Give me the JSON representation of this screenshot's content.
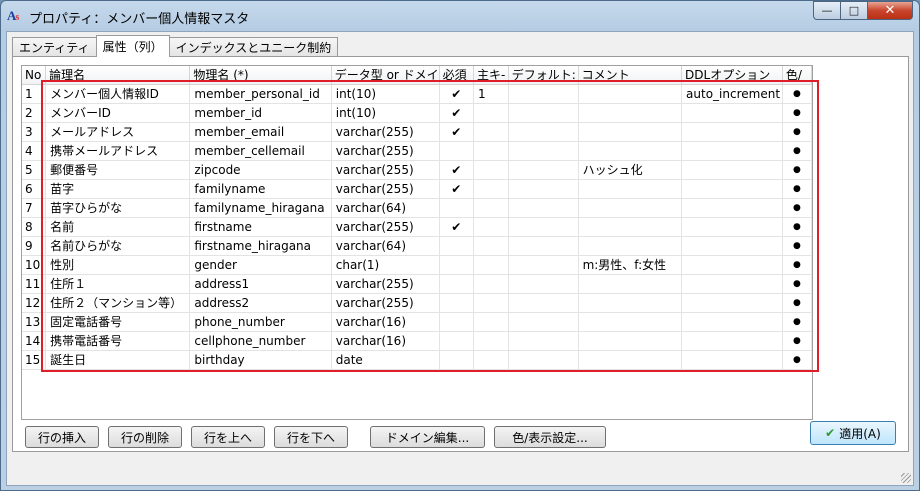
{
  "window": {
    "title": "プロパティ：メンバー個人情報マスタ",
    "app_icon": "As"
  },
  "title_buttons": {
    "minimize": "—",
    "maximize": "□",
    "close": "✕"
  },
  "tabs": [
    {
      "label": "エンティティ",
      "active": false
    },
    {
      "label": "属性（列）",
      "active": true
    },
    {
      "label": "インデックスとユニーク制約",
      "active": false
    }
  ],
  "table": {
    "headers": [
      "No",
      "論理名",
      "物理名 (*)",
      "データ型 or ドメイ",
      "必須",
      "主キ-",
      "デフォルト:",
      "コメント",
      "DDLオプション",
      "色/"
    ],
    "rows": [
      {
        "no": "1",
        "logical": "メンバー個人情報ID",
        "physical": "member_personal_id",
        "type": "int(10)",
        "required": "✔",
        "pk": "1",
        "default": "",
        "comment": "",
        "ddl": "auto_increment",
        "color": "●"
      },
      {
        "no": "2",
        "logical": "メンバーID",
        "physical": "member_id",
        "type": "int(10)",
        "required": "✔",
        "pk": "",
        "default": "",
        "comment": "",
        "ddl": "",
        "color": "●"
      },
      {
        "no": "3",
        "logical": "メールアドレス",
        "physical": "member_email",
        "type": "varchar(255)",
        "required": "✔",
        "pk": "",
        "default": "",
        "comment": "",
        "ddl": "",
        "color": "●"
      },
      {
        "no": "4",
        "logical": "携帯メールアドレス",
        "physical": "member_cellemail",
        "type": "varchar(255)",
        "required": "",
        "pk": "",
        "default": "",
        "comment": "",
        "ddl": "",
        "color": "●"
      },
      {
        "no": "5",
        "logical": "郵便番号",
        "physical": "zipcode",
        "type": "varchar(255)",
        "required": "✔",
        "pk": "",
        "default": "",
        "comment": "ハッシュ化",
        "ddl": "",
        "color": "●"
      },
      {
        "no": "6",
        "logical": "苗字",
        "physical": "familyname",
        "type": "varchar(255)",
        "required": "✔",
        "pk": "",
        "default": "",
        "comment": "",
        "ddl": "",
        "color": "●"
      },
      {
        "no": "7",
        "logical": "苗字ひらがな",
        "physical": "familyname_hiragana",
        "type": "varchar(64)",
        "required": "",
        "pk": "",
        "default": "",
        "comment": "",
        "ddl": "",
        "color": "●"
      },
      {
        "no": "8",
        "logical": "名前",
        "physical": "firstname",
        "type": "varchar(255)",
        "required": "✔",
        "pk": "",
        "default": "",
        "comment": "",
        "ddl": "",
        "color": "●"
      },
      {
        "no": "9",
        "logical": "名前ひらがな",
        "physical": "firstname_hiragana",
        "type": "varchar(64)",
        "required": "",
        "pk": "",
        "default": "",
        "comment": "",
        "ddl": "",
        "color": "●"
      },
      {
        "no": "10",
        "logical": "性別",
        "physical": "gender",
        "type": "char(1)",
        "required": "",
        "pk": "",
        "default": "",
        "comment": "m:男性、f:女性",
        "ddl": "",
        "color": "●"
      },
      {
        "no": "11",
        "logical": "住所１",
        "physical": "address1",
        "type": "varchar(255)",
        "required": "",
        "pk": "",
        "default": "",
        "comment": "",
        "ddl": "",
        "color": "●"
      },
      {
        "no": "12",
        "logical": "住所２（マンション等）",
        "physical": "address2",
        "type": "varchar(255)",
        "required": "",
        "pk": "",
        "default": "",
        "comment": "",
        "ddl": "",
        "color": "●"
      },
      {
        "no": "13",
        "logical": "固定電話番号",
        "physical": "phone_number",
        "type": "varchar(16)",
        "required": "",
        "pk": "",
        "default": "",
        "comment": "",
        "ddl": "",
        "color": "●"
      },
      {
        "no": "14",
        "logical": "携帯電話番号",
        "physical": "cellphone_number",
        "type": "varchar(16)",
        "required": "",
        "pk": "",
        "default": "",
        "comment": "",
        "ddl": "",
        "color": "●"
      },
      {
        "no": "15",
        "logical": "誕生日",
        "physical": "birthday",
        "type": "date",
        "required": "",
        "pk": "",
        "default": "",
        "comment": "",
        "ddl": "",
        "color": "●"
      }
    ]
  },
  "buttons": {
    "insert_row": "行の挿入",
    "delete_row": "行の削除",
    "row_up": "行を上へ",
    "row_down": "行を下へ",
    "domain_edit": "ドメイン編集...",
    "color_settings": "色/表示設定...",
    "apply": "適用(A)",
    "apply_check": "✔"
  },
  "colors": {
    "highlight": "#e01e2a"
  }
}
